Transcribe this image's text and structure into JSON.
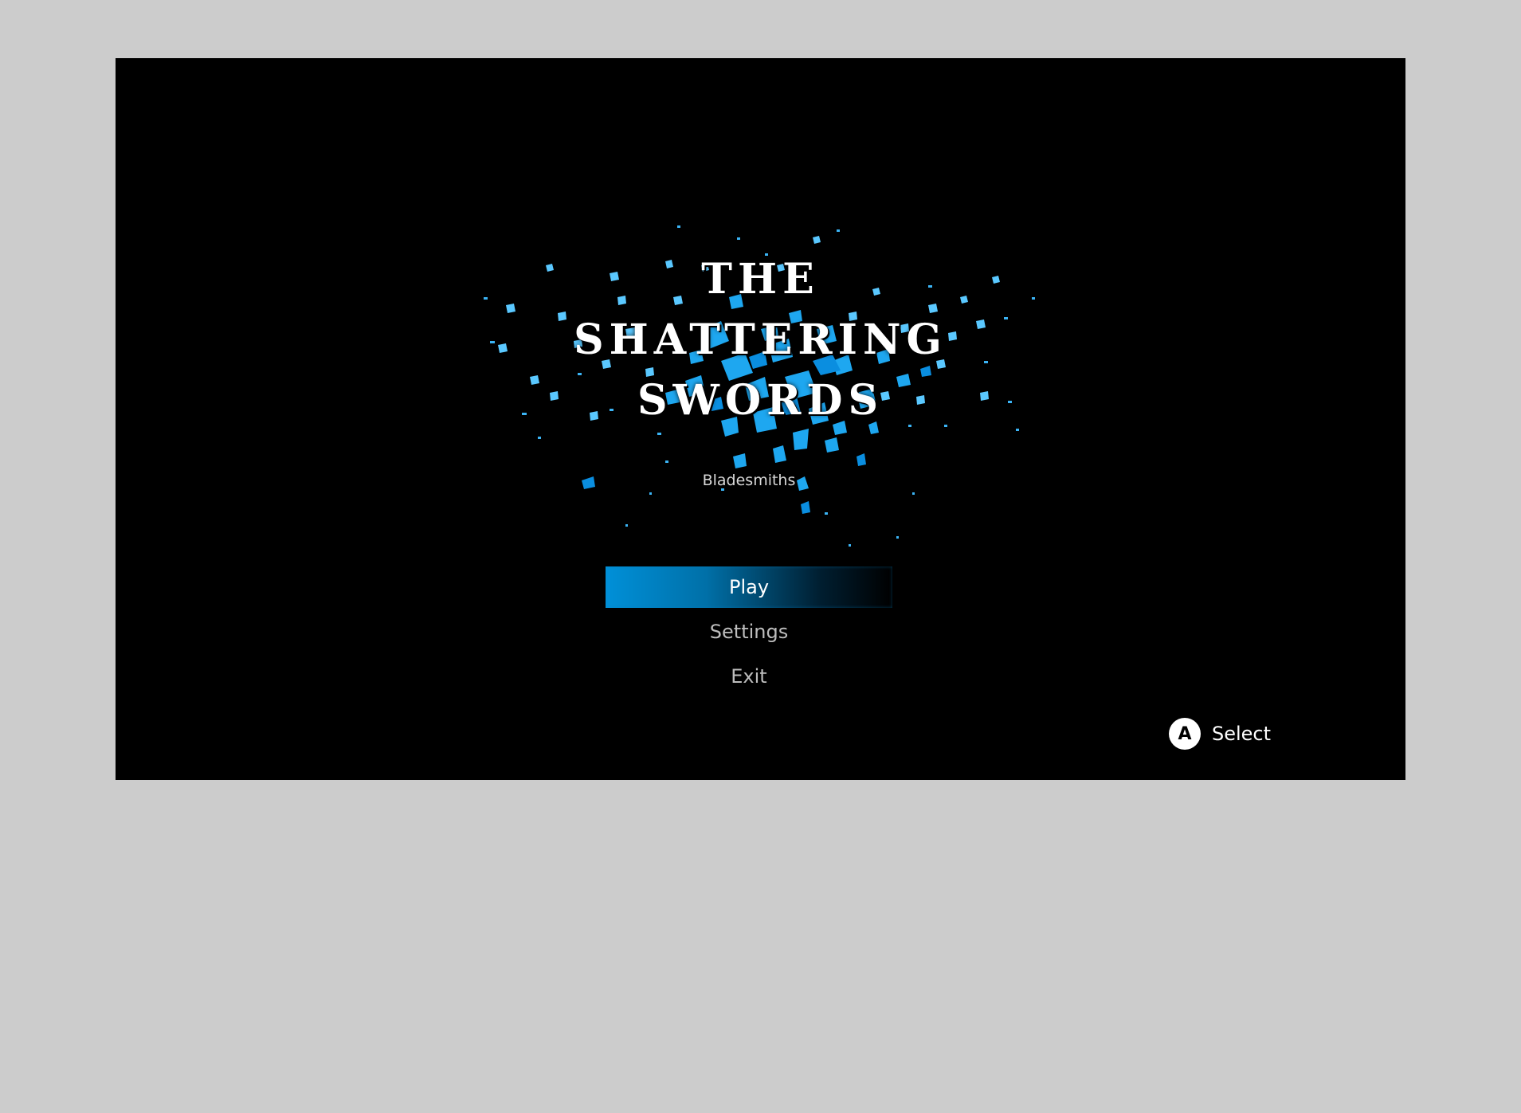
{
  "title": {
    "line1": "THE",
    "line2": "SHATTERING",
    "line3": "SWORDS"
  },
  "studio": "Bladesmiths",
  "menu": {
    "items": [
      {
        "label": "Play",
        "selected": true
      },
      {
        "label": "Settings",
        "selected": false
      },
      {
        "label": "Exit",
        "selected": false
      }
    ]
  },
  "hint": {
    "button_glyph": "A",
    "label": "Select"
  },
  "colors": {
    "background": "#000000",
    "accent": "#0090d8",
    "shard_bright": "#5ac8ff",
    "shard_dark": "#0a8ee0"
  }
}
